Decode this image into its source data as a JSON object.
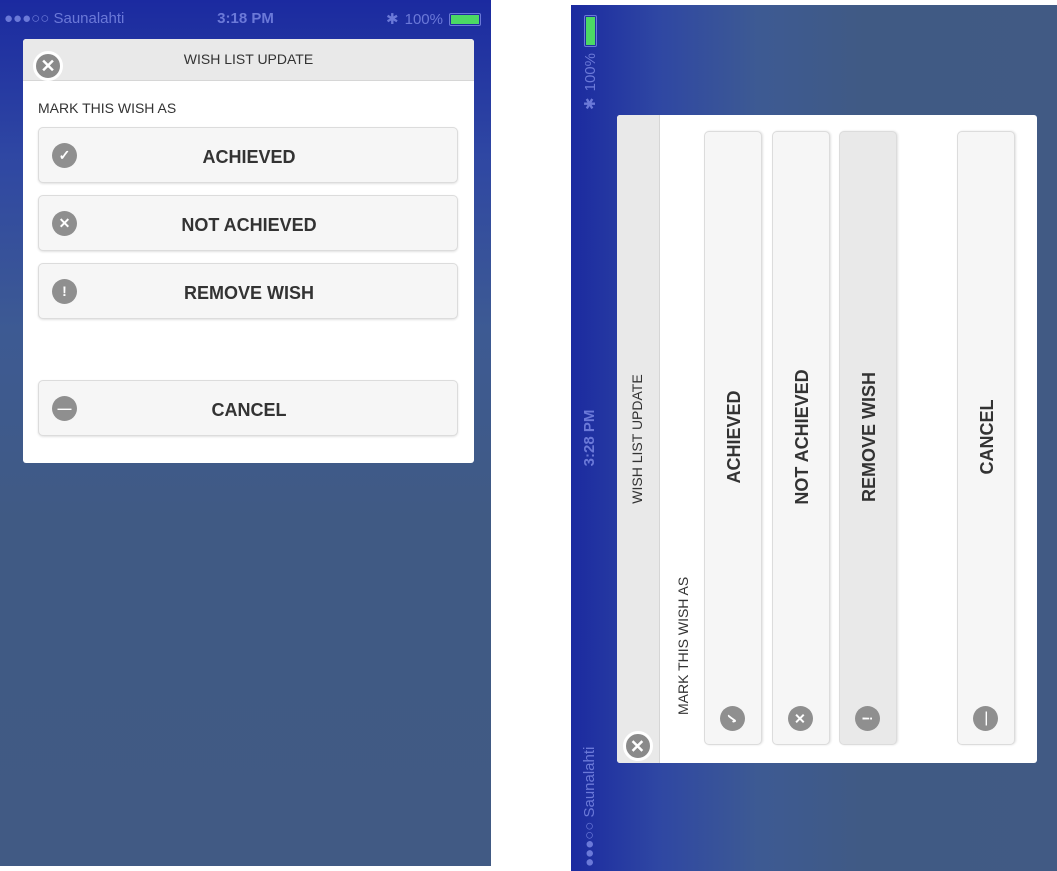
{
  "statusbar": {
    "carrier": "●●●○○ Saunalahti",
    "time_left": "3:18 PM",
    "time_right": "3:28 PM",
    "battery_pct": "100%",
    "battery_level": 1.0
  },
  "dialog": {
    "title": "WISH LIST UPDATE",
    "subtitle": "MARK THIS WISH AS",
    "close_icon": "x-circle-icon",
    "options": [
      {
        "label": "ACHIEVED",
        "icon": "check-icon"
      },
      {
        "label": "NOT ACHIEVED",
        "icon": "x-circle-icon"
      },
      {
        "label": "REMOVE WISH",
        "icon": "warning-icon"
      }
    ],
    "cancel": {
      "label": "CANCEL",
      "icon": "minus-circle-icon"
    }
  },
  "colors": {
    "status_text": "#6b79d8",
    "battery": "#4cd964",
    "background": "#415a84"
  }
}
